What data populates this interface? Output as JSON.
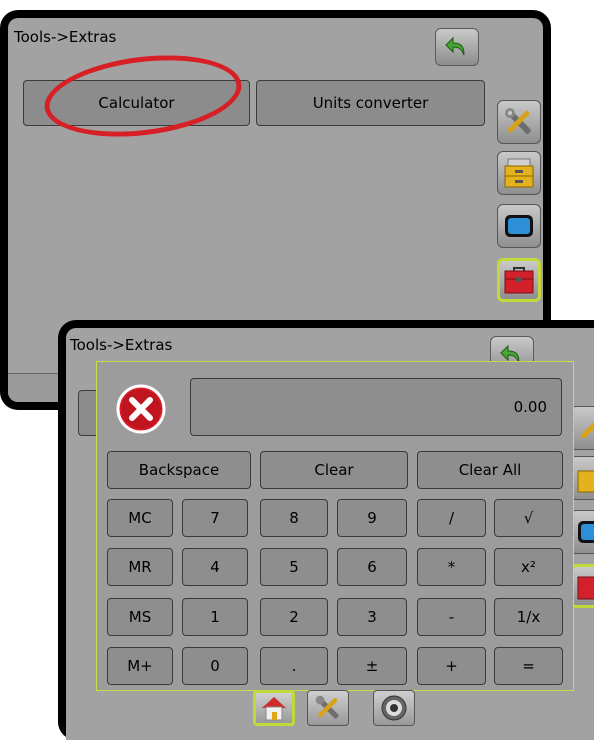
{
  "back_window": {
    "title": "Tools->Extras",
    "tabs": [
      "Calculator",
      "Units converter"
    ],
    "side_icons": [
      "tools-icon",
      "storage-drawers-icon",
      "display-icon",
      "toolbox-icon"
    ]
  },
  "front_window": {
    "title": "Tools->Extras"
  },
  "calculator": {
    "display_value": "0.00",
    "top_row": [
      "Backspace",
      "Clear",
      "Clear All"
    ],
    "rows": [
      [
        "MC",
        "7",
        "8",
        "9",
        "/",
        "√"
      ],
      [
        "MR",
        "4",
        "5",
        "6",
        "*",
        "x²"
      ],
      [
        "MS",
        "1",
        "2",
        "3",
        "-",
        "1/x"
      ],
      [
        "M+",
        "0",
        ".",
        "±",
        "+",
        "="
      ]
    ]
  },
  "colors": {
    "panel": "#a2a2a2",
    "key": "#8e8e8e",
    "highlight": "#c3d93a",
    "annotation": "#d71f26"
  },
  "nav_icons": [
    "home-icon",
    "tools-icon",
    "gps-target-icon"
  ]
}
